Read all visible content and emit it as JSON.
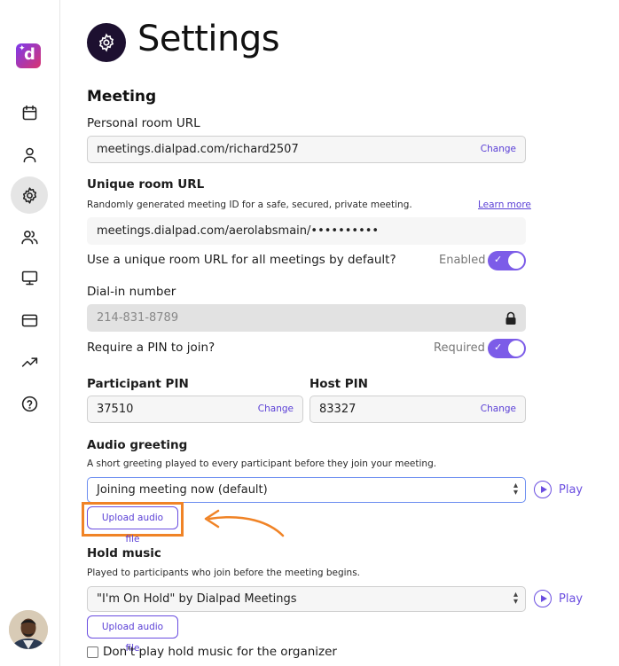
{
  "page": {
    "title": "Settings"
  },
  "sidebar": {
    "logo_letter": "d",
    "items": [
      {
        "icon": "calendar-icon"
      },
      {
        "icon": "user-icon"
      },
      {
        "icon": "gear-icon",
        "active": true
      },
      {
        "icon": "users-icon"
      },
      {
        "icon": "monitor-icon"
      },
      {
        "icon": "credit-card-icon"
      },
      {
        "icon": "trending-up-icon"
      },
      {
        "icon": "help-icon"
      }
    ]
  },
  "meeting": {
    "section_title": "Meeting",
    "personal_room": {
      "label": "Personal room URL",
      "value": "meetings.dialpad.com/richard2507",
      "change_label": "Change"
    },
    "unique_room": {
      "label": "Unique room URL",
      "helper": "Randomly generated meeting ID for a safe, secured, private meeting.",
      "learn_more": "Learn more",
      "value": "meetings.dialpad.com/aerolabsmain/••••••••••",
      "default_question": "Use a unique room URL for all meetings by default?",
      "default_status": "Enabled",
      "default_enabled": true
    },
    "dial_in": {
      "label": "Dial-in number",
      "value": "214-831-8789",
      "pin_question": "Require a PIN to join?",
      "pin_status": "Required",
      "pin_required": true
    },
    "participant_pin": {
      "label": "Participant PIN",
      "value": "37510",
      "change_label": "Change"
    },
    "host_pin": {
      "label": "Host PIN",
      "value": "83327",
      "change_label": "Change"
    },
    "audio_greeting": {
      "label": "Audio greeting",
      "helper": "A short greeting played to every participant before they join your meeting.",
      "selected": "Joining meeting now (default)",
      "play_label": "Play",
      "upload_label": "Upload audio file"
    },
    "hold_music": {
      "label": "Hold music",
      "helper": "Played to participants who join before the meeting begins.",
      "selected": "\"I'm On Hold\" by Dialpad Meetings",
      "play_label": "Play",
      "upload_label": "Upload audio file",
      "organizer_checkbox_label": "Don't play hold music for the organizer",
      "organizer_checkbox_checked": false
    }
  },
  "colors": {
    "accent": "#6a4de0",
    "toggle": "#7c5ce8",
    "highlight": "#f08326",
    "title_icon_bg": "#1d1030"
  }
}
